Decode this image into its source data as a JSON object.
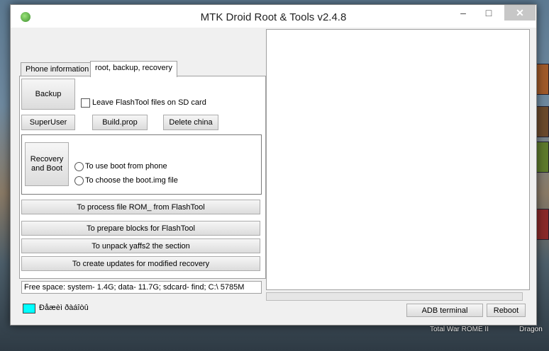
{
  "window": {
    "title": "MTK Droid Root & Tools v2.4.8",
    "minimize_glyph": "–",
    "maximize_glyph": "□",
    "close_glyph": "✕"
  },
  "tabs": [
    {
      "label": "Phone information",
      "active": false
    },
    {
      "label": "root, backup, recovery",
      "active": true
    }
  ],
  "backup": {
    "button_label": "Backup",
    "leave_flashtool_label": "Leave FlashTool files on SD card",
    "leave_flashtool_checked": false
  },
  "row_buttons": {
    "superuser": "SuperUser",
    "buildprop": "Build.prop",
    "delete_china": "Delete china"
  },
  "recovery": {
    "button_label": "Recovery and Boot",
    "option_phone": "To use boot from phone",
    "option_file": "To choose the boot.img file"
  },
  "actions": {
    "process_rom": "To process file ROM_ from FlashTool",
    "prepare_blocks": "To prepare blocks for FlashTool",
    "unpack_yaffs": "To unpack yaffs2 the section",
    "create_updates": "To create updates for modified recovery"
  },
  "status": {
    "free_space": "Free space: system- 1.4G; data- 11.7G; sdcard- find;  C:\\ 5785M",
    "indicator_text": "Ðåæèì ðàáîòû",
    "indicator_color": "#00ffff"
  },
  "bottom_buttons": {
    "adb_terminal": "ADB terminal",
    "reboot": "Reboot"
  },
  "desktop": {
    "taskbar_item_1": "Total War ROME II",
    "taskbar_item_2": "Dragon"
  }
}
